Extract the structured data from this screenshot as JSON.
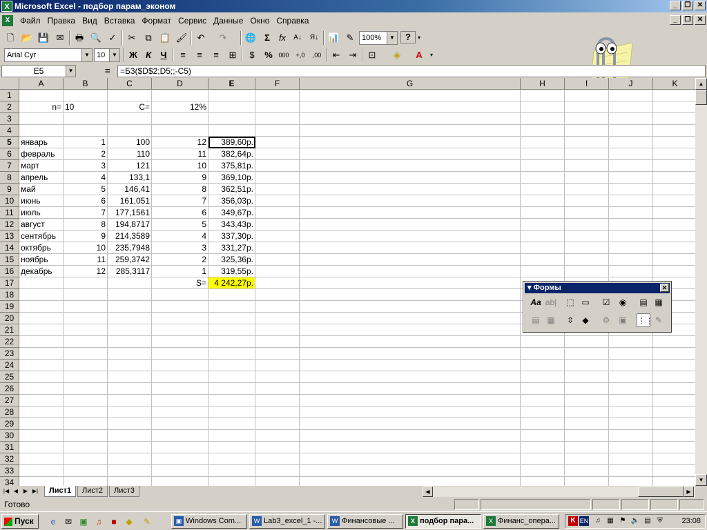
{
  "window": {
    "title": "Microsoft Excel - подбор парам_эконом"
  },
  "menu": [
    "Файл",
    "Правка",
    "Вид",
    "Вставка",
    "Формат",
    "Сервис",
    "Данные",
    "Окно",
    "Справка"
  ],
  "toolbar": {
    "zoom": "100%",
    "help_glyph": "?"
  },
  "format": {
    "font": "Arial Cyr",
    "size": "10",
    "bold": "Ж",
    "italic": "К",
    "underline": "Ч",
    "percent": "%",
    "thousands": "000"
  },
  "formula_bar": {
    "name_box": "E5",
    "equals": "=",
    "formula": "=Б3($D$2;D5;;-C5)"
  },
  "columns": [
    "A",
    "B",
    "C",
    "D",
    "E",
    "F",
    "G",
    "H",
    "I",
    "J",
    "K"
  ],
  "rows": [
    "1",
    "2",
    "3",
    "4",
    "5",
    "6",
    "7",
    "8",
    "9",
    "10",
    "11",
    "12",
    "13",
    "14",
    "15",
    "16",
    "17",
    "18",
    "19",
    "20",
    "21",
    "22",
    "23",
    "24",
    "25",
    "26",
    "27",
    "28",
    "29",
    "30",
    "31",
    "32",
    "33",
    "34"
  ],
  "cells": {
    "A2": "n=",
    "B2": "10",
    "C2": "C=",
    "D2": "12%",
    "A5": "январь",
    "B5": "1",
    "C5": "100",
    "D5": "12",
    "E5": "389,60р.",
    "A6": "февраль",
    "B6": "2",
    "C6": "110",
    "D6": "11",
    "E6": "382,64р.",
    "A7": "март",
    "B7": "3",
    "C7": "121",
    "D7": "10",
    "E7": "375,81р.",
    "A8": "апрель",
    "B8": "4",
    "C8": "133,1",
    "D8": "9",
    "E8": "369,10р.",
    "A9": "май",
    "B9": "5",
    "C9": "146,41",
    "D9": "8",
    "E9": "362,51р.",
    "A10": "июнь",
    "B10": "6",
    "C10": "161,051",
    "D10": "7",
    "E10": "356,03р.",
    "A11": "июль",
    "B11": "7",
    "C11": "177,1561",
    "D11": "6",
    "E11": "349,67р.",
    "A12": "август",
    "B12": "8",
    "C12": "194,8717",
    "D12": "5",
    "E12": "343,43р.",
    "A13": "сентябрь",
    "B13": "9",
    "C13": "214,3589",
    "D13": "4",
    "E13": "337,30р.",
    "A14": "октябрь",
    "B14": "10",
    "C14": "235,7948",
    "D14": "3",
    "E14": "331,27р.",
    "A15": "ноябрь",
    "B15": "11",
    "C15": "259,3742",
    "D15": "2",
    "E15": "325,36р.",
    "A16": "декабрь",
    "B16": "12",
    "C16": "285,3117",
    "D16": "1",
    "E16": "319,55р.",
    "D17": "S=",
    "E17": "4 242,27р."
  },
  "sheets": [
    "Лист1",
    "Лист2",
    "Лист3"
  ],
  "status": {
    "text": "Готово"
  },
  "forms_toolbar": {
    "title": "Формы"
  },
  "taskbar": {
    "start": "Пуск",
    "tasks": [
      "Windows Com...",
      "Lab3_excel_1 -...",
      "Финансовые ...",
      "подбор пара...",
      "Финанс_опера..."
    ],
    "lang": "EN",
    "clock": "23:08"
  },
  "colors": {
    "titlebar": "#0a246a",
    "highlight_cell": "#ffff00",
    "chrome": "#d4d0c8"
  }
}
